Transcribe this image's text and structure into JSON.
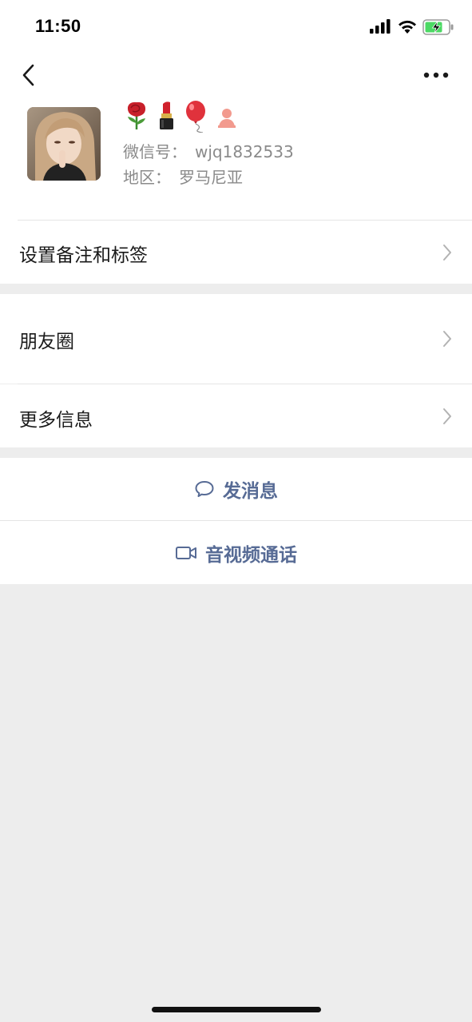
{
  "status_bar": {
    "time": "11:50"
  },
  "nav": {
    "back_icon": "chevron-left-icon",
    "more_icon": "ellipsis-icon"
  },
  "profile": {
    "emoji_icons": [
      "rose-icon",
      "lipstick-icon",
      "balloon-icon",
      "woman-icon"
    ],
    "wechat_id_label": "微信号：",
    "wechat_id_value": "wjq1832533",
    "region_label": "地区：",
    "region_value": "罗马尼亚"
  },
  "menu": {
    "remark_label": "设置备注和标签",
    "moments_label": "朋友圈",
    "more_info_label": "更多信息"
  },
  "actions": {
    "message_label": "发消息",
    "call_label": "音视频通话"
  },
  "colors": {
    "link_blue": "#576b95",
    "background_gray": "#ededed",
    "text_gray": "#8a8a8a"
  }
}
